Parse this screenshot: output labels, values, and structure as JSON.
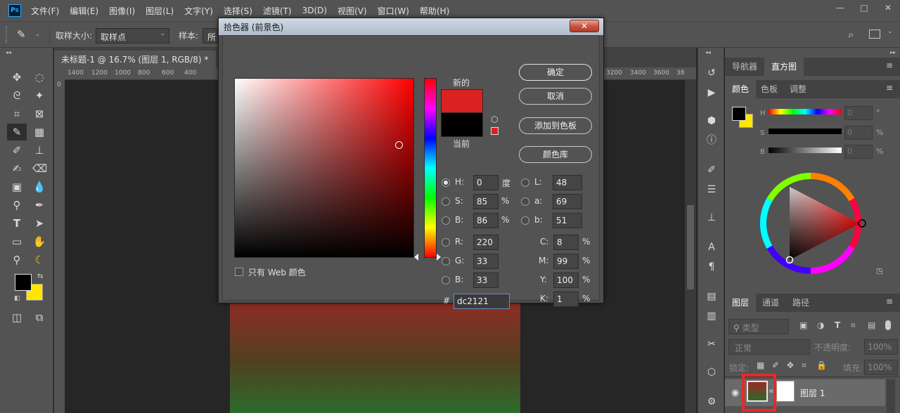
{
  "app": {
    "logo": "Ps"
  },
  "menu": [
    "文件(F)",
    "编辑(E)",
    "图像(I)",
    "图层(L)",
    "文字(Y)",
    "选择(S)",
    "滤镜(T)",
    "3D(D)",
    "视图(V)",
    "窗口(W)",
    "帮助(H)"
  ],
  "window_controls": {
    "minimize": "—",
    "restore": "□",
    "close": "✕"
  },
  "options_bar": {
    "sample_size_label": "取样大小:",
    "sample_size_value": "取样点",
    "sample_label": "样本:",
    "sample_value": "所"
  },
  "document": {
    "tab_title": "未标题-1 @ 16.7% (图层 1, RGB/8) *",
    "tab_close": "✕",
    "ruler_ticks_left": [
      "1400",
      "1200",
      "1000",
      "800",
      "600",
      "400"
    ],
    "ruler_ticks_right": [
      "3200",
      "3400",
      "3600",
      "38"
    ],
    "ruler_v_zero": "0"
  },
  "dialog": {
    "title": "拾色器 (前景色)",
    "close": "✕",
    "new_label": "新的",
    "current_label": "当前",
    "buttons": {
      "ok": "确定",
      "cancel": "取消",
      "add_swatch": "添加到色板",
      "libraries": "颜色库"
    },
    "web_only_label": "只有 Web 颜色",
    "new_color": "#dc2121",
    "current_color": "#000000",
    "fields": {
      "H": {
        "label": "H:",
        "value": "0",
        "unit": "度"
      },
      "S": {
        "label": "S:",
        "value": "85",
        "unit": "%"
      },
      "B": {
        "label": "B:",
        "value": "86",
        "unit": "%"
      },
      "R": {
        "label": "R:",
        "value": "220"
      },
      "G": {
        "label": "G:",
        "value": "33"
      },
      "Bl": {
        "label": "B:",
        "value": "33"
      },
      "L": {
        "label": "L:",
        "value": "48"
      },
      "a": {
        "label": "a:",
        "value": "69"
      },
      "b": {
        "label": "b:",
        "value": "51"
      },
      "C": {
        "label": "C:",
        "value": "8",
        "unit": "%"
      },
      "M": {
        "label": "M:",
        "value": "99",
        "unit": "%"
      },
      "Y": {
        "label": "Y:",
        "value": "100",
        "unit": "%"
      },
      "K": {
        "label": "K:",
        "value": "1",
        "unit": "%"
      }
    },
    "hex_label": "#",
    "hex_value": "dc2121"
  },
  "panels": {
    "top_tabs": [
      "导航器",
      "直方图"
    ],
    "color_tabs": [
      "颜色",
      "色板",
      "调整"
    ],
    "hsb_labels": [
      "H",
      "S",
      "B"
    ],
    "hsb_values": [
      "0",
      "0",
      "0"
    ],
    "hsb_units": [
      "°",
      "%",
      "%"
    ],
    "layer_tabs": [
      "图层",
      "通道",
      "路径"
    ],
    "layer_filter": "类型",
    "blend_mode": "正常",
    "opacity_label": "不透明度:",
    "opacity_value": "100%",
    "lock_label": "锁定:",
    "fill_label": "填充:",
    "fill_value": "100%",
    "layer_name": "图层 1"
  },
  "colors": {
    "foreground": "#000000",
    "background": "#ffe600",
    "accent": "#e62a2a"
  }
}
